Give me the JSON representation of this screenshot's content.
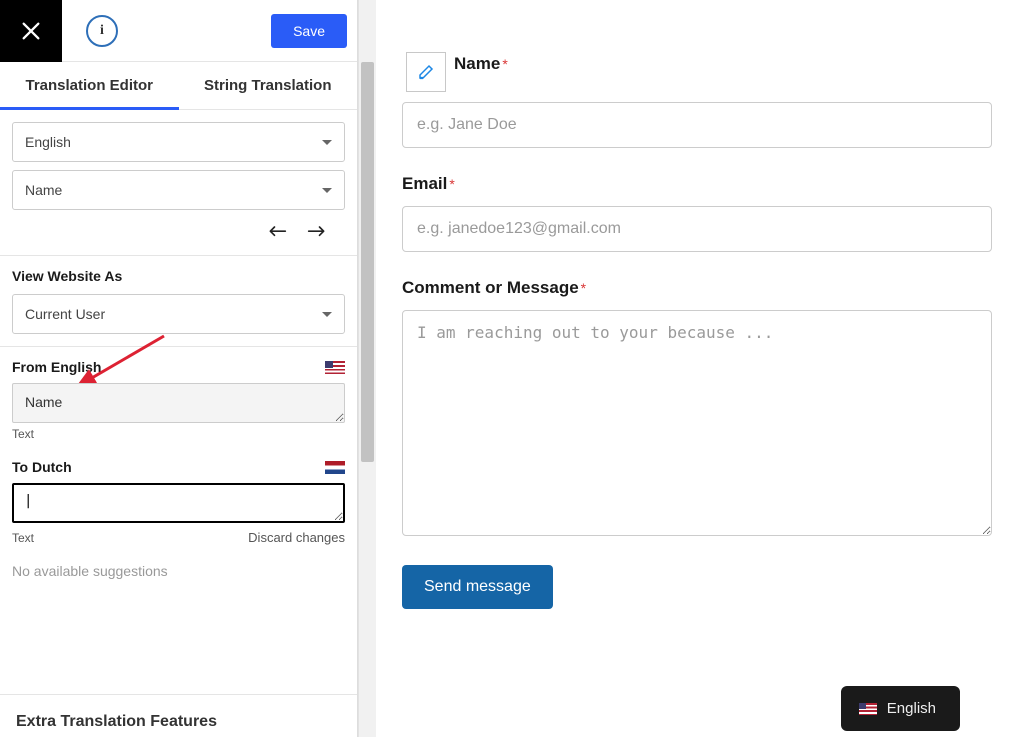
{
  "topbar": {
    "save_label": "Save",
    "info_glyph": "i"
  },
  "tabs": {
    "translation_editor": "Translation Editor",
    "string_translation": "String Translation"
  },
  "selectors": {
    "language": "English",
    "string": "Name"
  },
  "view_as": {
    "label": "View Website As",
    "value": "Current User"
  },
  "from": {
    "label": "From English",
    "value": "Name",
    "hint": "Text"
  },
  "to": {
    "label": "To Dutch",
    "value": "",
    "hint": "Text",
    "discard": "Discard changes"
  },
  "suggestions": "No available suggestions",
  "extra": "Extra Translation Features",
  "preview": {
    "name_label": "Name",
    "name_placeholder": "e.g. Jane Doe",
    "email_label": "Email",
    "email_placeholder": "e.g. janedoe123@gmail.com",
    "message_label": "Comment or Message",
    "message_placeholder": "I am reaching out to your because ...",
    "send": "Send message"
  },
  "lang_switch": "English"
}
